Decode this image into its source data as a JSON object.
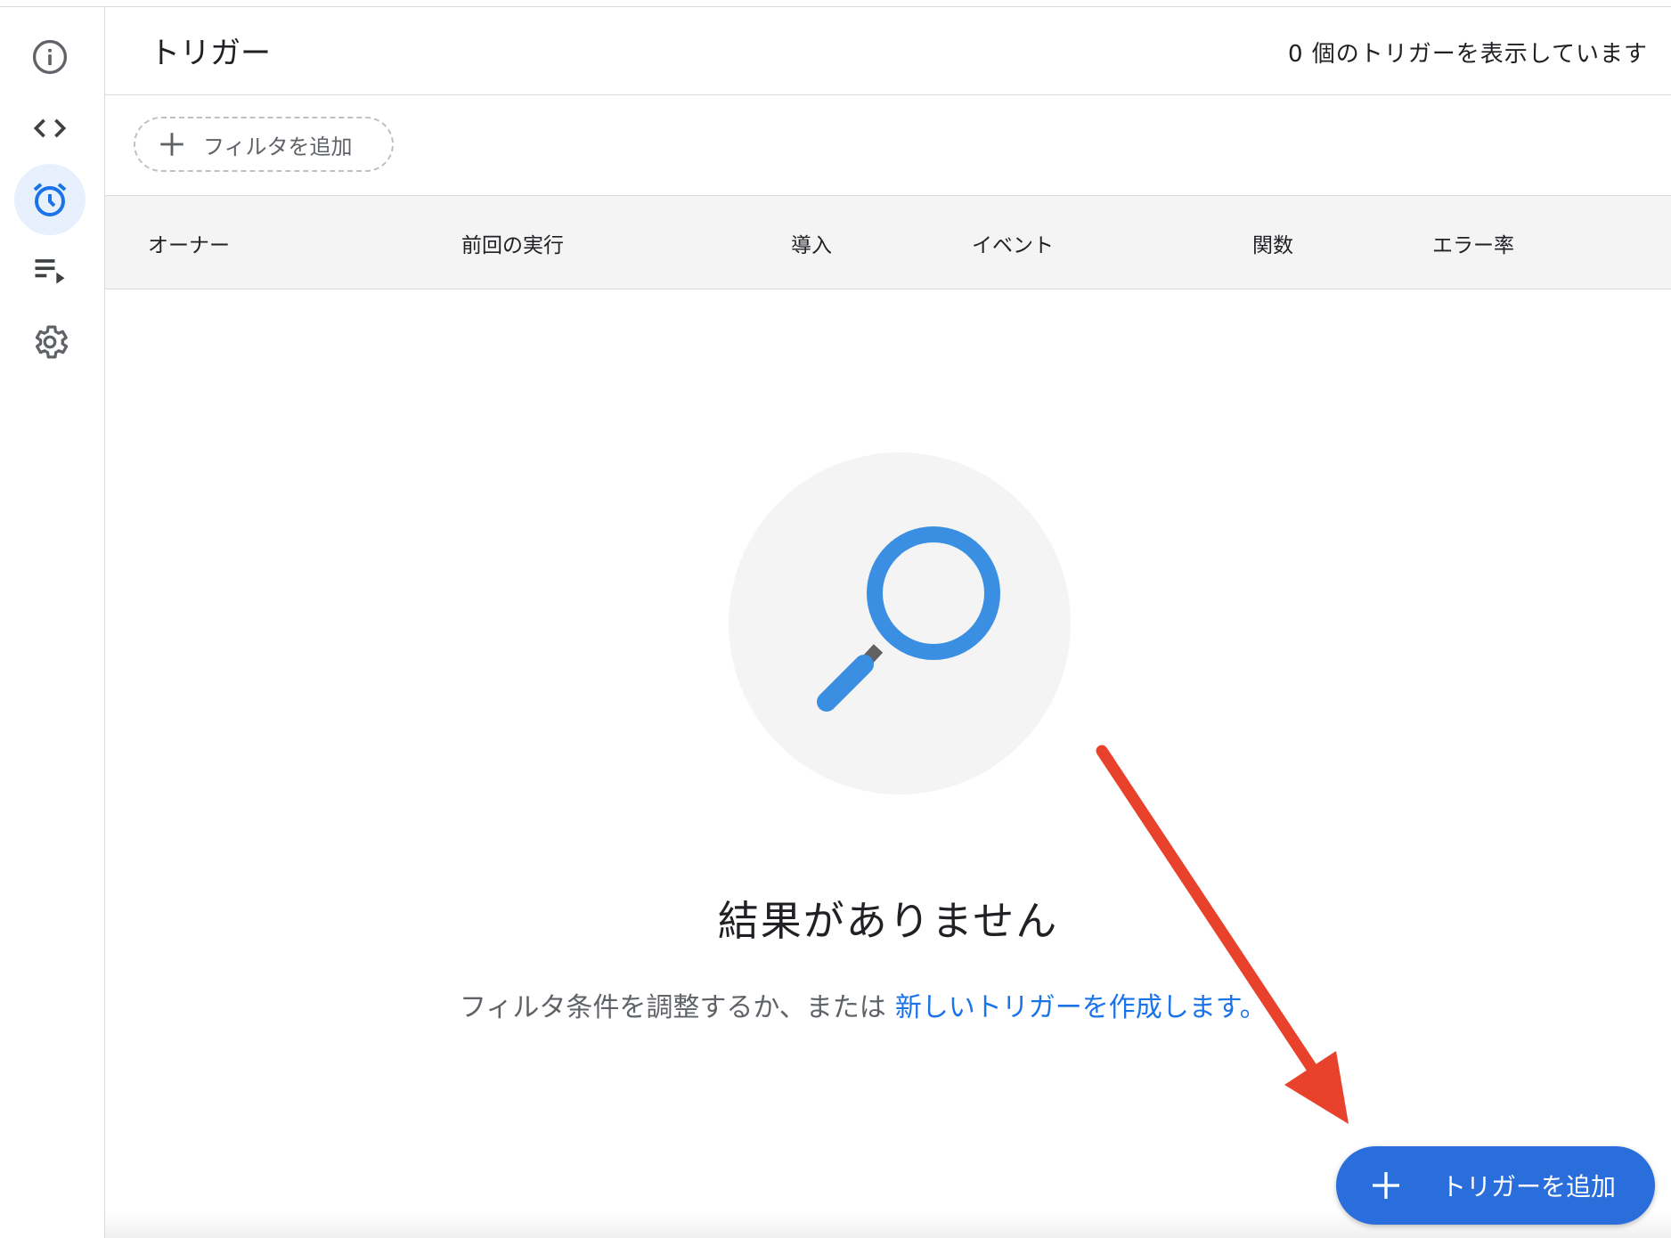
{
  "header": {
    "title": "トリガー",
    "count_text": "0 個のトリガーを表示しています"
  },
  "filter": {
    "add_filter_label": "フィルタを追加"
  },
  "table": {
    "columns": [
      "オーナー",
      "前回の実行",
      "導入",
      "イベント",
      "関数",
      "エラー率"
    ]
  },
  "empty_state": {
    "title": "結果がありません",
    "message": "フィルタ条件を調整するか、または",
    "link_text": "新しいトリガーを作成します。"
  },
  "fab": {
    "label": "トリガーを追加"
  },
  "sidebar": {
    "items": [
      {
        "icon": "info-icon"
      },
      {
        "icon": "code-icon"
      },
      {
        "icon": "alarm-clock-icon",
        "active": true
      },
      {
        "icon": "executions-icon"
      },
      {
        "icon": "gear-icon"
      }
    ]
  },
  "colors": {
    "accent": "#2a6edb",
    "link": "#1a73e8",
    "annotation_arrow": "#e8412c"
  }
}
